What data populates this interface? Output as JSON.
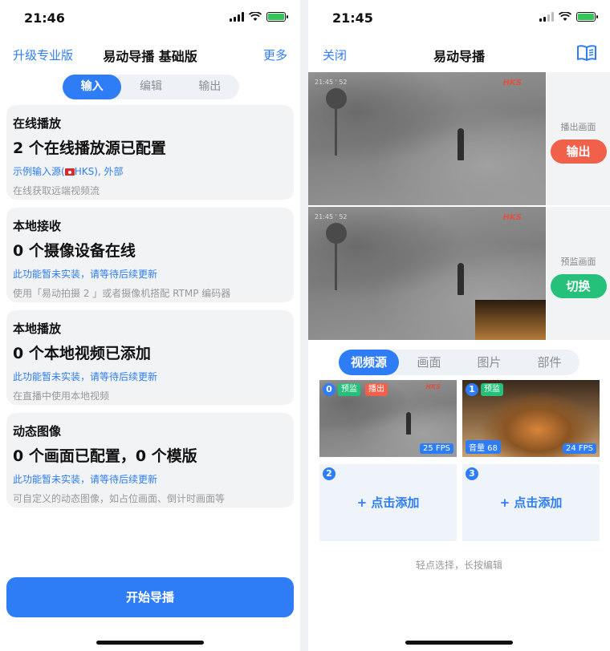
{
  "left": {
    "status": {
      "time": "21:46"
    },
    "nav": {
      "left_link": "升级专业版",
      "title": "易动导播 基础版",
      "right_link": "更多"
    },
    "segments": [
      "输入",
      "编辑",
      "输出"
    ],
    "cards": [
      {
        "title": "在线播放",
        "headline": "2 个在线播放源已配置",
        "blue_prefix": "示例输入源(",
        "blue_suffix": "HKS), 外部",
        "gray": "在线获取远端视频流"
      },
      {
        "title": "本地接收",
        "headline": "0 个摄像设备在线",
        "blue": "此功能暂未实装，请等待后续更新",
        "gray": "使用「易动拍摄 2 」或者摄像机搭配 RTMP 编码器"
      },
      {
        "title": "本地播放",
        "headline": "0 个本地视频已添加",
        "blue": "此功能暂未实装，请等待后续更新",
        "gray": "在直播中使用本地视频"
      },
      {
        "title": "动态图像",
        "headline": "0 个画面已配置，0 个模版",
        "blue": "此功能暂未实装，请等待后续更新",
        "gray": "可自定义的动态图像，如占位画面、倒计时画面等"
      }
    ],
    "start_button": "开始导播"
  },
  "right": {
    "status": {
      "time": "21:45"
    },
    "nav": {
      "left_link": "关闭",
      "title": "易动导播"
    },
    "program": {
      "label": "播出画面",
      "button": "输出",
      "hud": "21:45 ' 52",
      "logo": "HKS"
    },
    "preview": {
      "label": "预监画面",
      "button": "切换",
      "hud": "21:45 ' 52",
      "logo": "HKS"
    },
    "tabs": [
      "视频源",
      "画面",
      "图片",
      "部件"
    ],
    "sources": [
      {
        "num": "0",
        "tag1": "预监",
        "tag2": "播出",
        "fps": "25 FPS",
        "logo": "HKS"
      },
      {
        "num": "1",
        "tag1": "预监",
        "volume": "音量 68",
        "fps": "24 FPS"
      },
      {
        "num": "2",
        "add": "+ 点击添加"
      },
      {
        "num": "3",
        "add": "+ 点击添加"
      }
    ],
    "hint": "轻点选择，长按编辑"
  },
  "colors": {
    "accent": "#2f7df6",
    "output_red": "#f0604a",
    "switch_green": "#25c17a",
    "preview_tag": "#25c17a",
    "program_tag": "#f0604a"
  }
}
